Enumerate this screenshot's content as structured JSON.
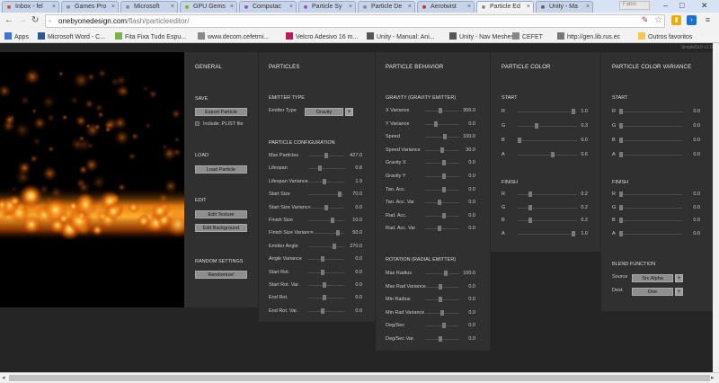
{
  "tabs": [
    {
      "label": "Inbox - fel",
      "icon": "gmail-icon",
      "color": "#d44638"
    },
    {
      "label": "Games Pro",
      "icon": "doc-icon",
      "color": "#888888"
    },
    {
      "label": "Microsoft",
      "icon": "doc-icon",
      "color": "#888888"
    },
    {
      "label": "GPU Gems",
      "icon": "nvidia-icon",
      "color": "#76b900"
    },
    {
      "label": "Computac",
      "icon": "wiki-icon",
      "color": "#8a4fb0"
    },
    {
      "label": "Particle Sy",
      "icon": "wiki-icon",
      "color": "#8a4fb0"
    },
    {
      "label": "Particle De",
      "icon": "doc-icon",
      "color": "#888888"
    },
    {
      "label": "Aerotwist",
      "icon": "aerotwist-icon",
      "color": "#cc2222"
    },
    {
      "label": "Particle Ed",
      "icon": "doc-icon",
      "color": "#888888"
    },
    {
      "label": "Unity - Ma",
      "icon": "unity-icon",
      "color": "#555555"
    }
  ],
  "window": {
    "profile": "Fabio",
    "minimize": "–",
    "maximize": "□",
    "close": "✕"
  },
  "address": {
    "host": "onebyonedesign.com",
    "path": "/flash/particleeditor/"
  },
  "bookmarks": [
    {
      "label": "Apps",
      "icon": "apps-icon",
      "color": "#3b73d8"
    },
    {
      "label": "Microsoft Word - C...",
      "icon": "word-icon",
      "color": "#2b5797"
    },
    {
      "label": "Fita Fixa Tudo Espu...",
      "icon": "folder-icon",
      "color": "#7cb342"
    },
    {
      "label": "www.decom.cefetmi...",
      "icon": "doc-icon",
      "color": "#888888"
    },
    {
      "label": "Velcro Adesivo 16 m...",
      "icon": "ml-icon",
      "color": "#c2185b"
    },
    {
      "label": "Unity - Manual: Ani...",
      "icon": "unity-icon",
      "color": "#555555"
    },
    {
      "label": "Unity - Nav Meshes",
      "icon": "unity-icon",
      "color": "#555555"
    },
    {
      "label": "CEFET",
      "icon": "doc-icon",
      "color": "#888888"
    },
    {
      "label": "http://gen.lib.rus.ec",
      "icon": "globe-icon",
      "color": "#777777"
    },
    {
      "label": "Outros favoritos",
      "icon": "folder-icon",
      "color": "#f2c94c"
    }
  ],
  "app": {
    "version": "SimpleGUI v1.0.2",
    "general": {
      "title": "GENERAL",
      "save_title": "SAVE",
      "export_label": "Export Particle",
      "include_plist": "Include .PLIST file",
      "load_title": "LOAD",
      "load_label": "Load Particle",
      "edit_title": "EDIT",
      "edit_texture": "Edit Texture",
      "edit_background": "Edit Background",
      "random_title": "RANDOM SETTINGS",
      "randomize": "Randomize!"
    },
    "particles": {
      "title": "PARTICLES",
      "emitter_type_title": "EMITTER TYPE",
      "emitter_type_label": "Emitter Type",
      "emitter_type_value": "Gravity",
      "config_title": "PARTICLE CONFIGURATION",
      "rows": [
        {
          "label": "Max Particles",
          "value": "427.0",
          "pos": 0.5
        },
        {
          "label": "Lifespan",
          "value": "0.8",
          "pos": 0.3
        },
        {
          "label": "Lifespan Variance",
          "value": "1.9",
          "pos": 0.45
        },
        {
          "label": "Start Size",
          "value": "70.0",
          "pos": 0.92
        },
        {
          "label": "Start Size Variance",
          "value": "0.0",
          "pos": 0.5
        },
        {
          "label": "Finish Size",
          "value": "10.0",
          "pos": 0.7
        },
        {
          "label": "Finish Size Variance",
          "value": "50.0",
          "pos": 0.85
        },
        {
          "label": "Emitter Angle",
          "value": "270.0",
          "pos": 0.75
        },
        {
          "label": "Angle Variance",
          "value": "0.0",
          "pos": 0.4
        },
        {
          "label": "Start Rot.",
          "value": "0.0",
          "pos": 0.4
        },
        {
          "label": "Start Rot. Var.",
          "value": "0.0",
          "pos": 0.45
        },
        {
          "label": "End Rot.",
          "value": "0.0",
          "pos": 0.45
        },
        {
          "label": "End Rot. Var.",
          "value": "0.0",
          "pos": 0.38
        }
      ]
    },
    "behavior": {
      "title": "PARTICLE BEHAVIOR",
      "gravity_title": "GRAVITY (GRAVITY EMITTER)",
      "gravity_rows": [
        {
          "label": "X Variance",
          "value": "300.0",
          "pos": 0.45
        },
        {
          "label": "Y Variance",
          "value": "0.0",
          "pos": 0.3
        },
        {
          "label": "Speed",
          "value": "100.0",
          "pos": 0.6
        },
        {
          "label": "Speed Variance",
          "value": "30.0",
          "pos": 0.5
        },
        {
          "label": "Gravity X",
          "value": "0.0",
          "pos": 0.55
        },
        {
          "label": "Gravity Y",
          "value": "0.0",
          "pos": 0.55
        },
        {
          "label": "Tan. Acc.",
          "value": "0.0",
          "pos": 0.55
        },
        {
          "label": "Tan. Acc. Var",
          "value": "0.0",
          "pos": 0.4
        },
        {
          "label": "Rad. Acc.",
          "value": "0.0",
          "pos": 0.55
        },
        {
          "label": "Rad. Acc. Var",
          "value": "0.0",
          "pos": 0.4
        }
      ],
      "rotation_title": "ROTATION (RADIAL EMITTER)",
      "rotation_rows": [
        {
          "label": "Max Radius",
          "value": "100.0",
          "pos": 0.62
        },
        {
          "label": "Max Rad Variance",
          "value": "0.0",
          "pos": 0.45
        },
        {
          "label": "Min Radius",
          "value": "0.0",
          "pos": 0.45
        },
        {
          "label": "Min Rad Variance",
          "value": "0.0",
          "pos": 0.5
        },
        {
          "label": "Deg/Sec",
          "value": "0.0",
          "pos": 0.55
        },
        {
          "label": "Deg/Sec Var.",
          "value": "0.0",
          "pos": 0.45
        }
      ]
    },
    "color": {
      "title": "PARTICLE COLOR",
      "start_title": "START",
      "start_rows": [
        {
          "label": "R",
          "value": "1.0",
          "pos": 0.97
        },
        {
          "label": "G",
          "value": "0.3",
          "pos": 0.3
        },
        {
          "label": "B",
          "value": "0.0",
          "pos": 0.0
        },
        {
          "label": "A",
          "value": "0.6",
          "pos": 0.6
        }
      ],
      "finish_title": "FINISH",
      "finish_rows": [
        {
          "label": "R",
          "value": "0.2",
          "pos": 0.2
        },
        {
          "label": "G",
          "value": "0.2",
          "pos": 0.2
        },
        {
          "label": "B",
          "value": "0.2",
          "pos": 0.2
        },
        {
          "label": "A",
          "value": "1.0",
          "pos": 0.97
        }
      ]
    },
    "variance": {
      "title": "PARTICLE COLOR VARIANCE",
      "start_title": "START",
      "start_rows": [
        {
          "label": "R",
          "value": "0.0",
          "pos": 0.0
        },
        {
          "label": "G",
          "value": "0.0",
          "pos": 0.0
        },
        {
          "label": "B",
          "value": "0.0",
          "pos": 0.0
        },
        {
          "label": "A",
          "value": "0.0",
          "pos": 0.0
        }
      ],
      "finish_title": "FINISH",
      "finish_rows": [
        {
          "label": "R",
          "value": "0.0",
          "pos": 0.0
        },
        {
          "label": "G",
          "value": "0.0",
          "pos": 0.0
        },
        {
          "label": "B",
          "value": "0.0",
          "pos": 0.0
        },
        {
          "label": "A",
          "value": "0.0",
          "pos": 0.0
        }
      ],
      "blend_title": "BLEND FUNCTION",
      "source_label": "Source",
      "source_value": "Src Alpha",
      "dest_label": "Dest.",
      "dest_value": "One"
    }
  }
}
